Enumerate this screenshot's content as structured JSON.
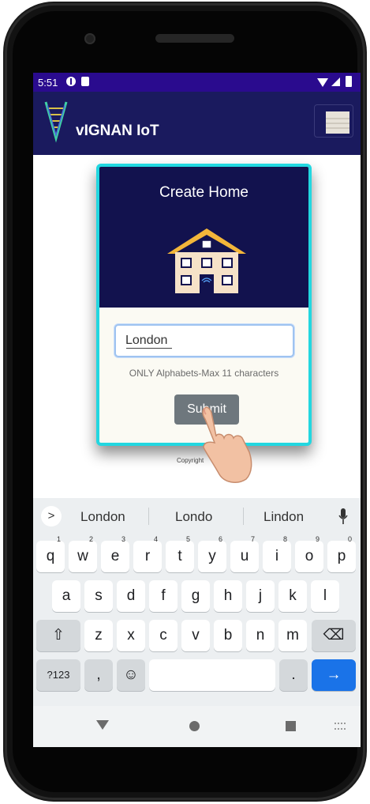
{
  "status_bar": {
    "time": "5:51"
  },
  "app": {
    "title": "vIGNAN IoT"
  },
  "dialog": {
    "title": "Create Home",
    "input_value": "London",
    "hint": "ONLY Alphabets-Max 11 characters",
    "submit_label": "Submit"
  },
  "footer": {
    "copyright": "Copyright"
  },
  "keyboard": {
    "expand_label": ">",
    "suggestions": [
      "London",
      "Londo",
      "Lindon"
    ],
    "row1": [
      "q",
      "w",
      "e",
      "r",
      "t",
      "y",
      "u",
      "i",
      "o",
      "p"
    ],
    "row1_hints": [
      "1",
      "2",
      "3",
      "4",
      "5",
      "6",
      "7",
      "8",
      "9",
      "0"
    ],
    "row2": [
      "a",
      "s",
      "d",
      "f",
      "g",
      "h",
      "j",
      "k",
      "l"
    ],
    "row3": [
      "z",
      "x",
      "c",
      "v",
      "b",
      "n",
      "m"
    ],
    "shift_label": "⇧",
    "backspace_label": "⌫",
    "symbols_label": "?123",
    "comma_label": ",",
    "emoji_label": "☺",
    "period_label": ".",
    "enter_label": "→"
  },
  "colors": {
    "status_bar": "#2a0b8e",
    "app_bar": "#1a1a5e",
    "card_header": "#12124e",
    "card_border": "#22d7e0",
    "submit": "#6e777d",
    "enter_key": "#1a73e8"
  }
}
